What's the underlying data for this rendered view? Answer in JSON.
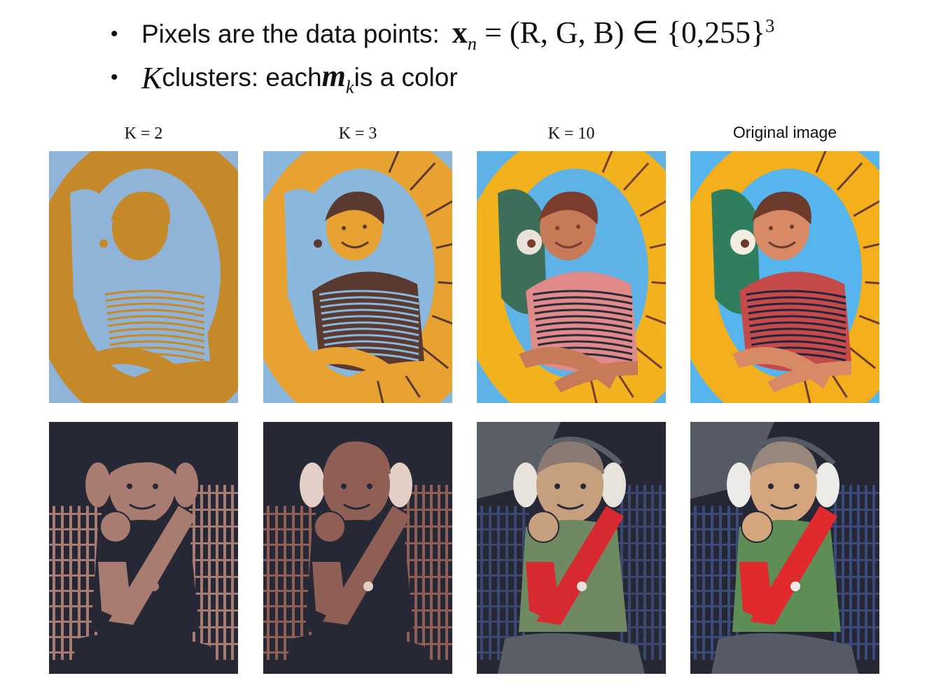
{
  "bullets": [
    {
      "text": "Pixels are the data points:",
      "math_var": "x",
      "math_sub": "n",
      "math_rest": " = (R, G, B) ∈ {0,255}",
      "math_sup": "3"
    },
    {
      "math_k": "K",
      "text": " clusters: each ",
      "math_m": "m",
      "math_m_sub": "k",
      "text2": " is a color"
    }
  ],
  "columns": [
    {
      "label": "K = 2"
    },
    {
      "label": "K = 3"
    },
    {
      "label": "K = 10"
    },
    {
      "label": "Original image"
    }
  ],
  "rows": [
    {
      "name": "boy-in-inflatable",
      "panels": [
        {
          "palette": [
            "#8fb4d8",
            "#c5892a"
          ]
        },
        {
          "palette": [
            "#8ab8dc",
            "#e8a232",
            "#5a3a30"
          ]
        },
        {
          "palette": [
            "#5fb2e6",
            "#f2b21e",
            "#c77a58",
            "#7a3d2e",
            "#e08a8a",
            "#3c6e5a",
            "#e9e2d8",
            "#2a2a38",
            "#a04a40",
            "#d4c0a0"
          ]
        },
        {
          "palette": [
            "#55b5ec",
            "#f4b01c",
            "#d88a66",
            "#6b3b2c",
            "#c54a4a",
            "#2f7f5e",
            "#f3ece0",
            "#24243a",
            "#e0a070",
            "#8fd0f0"
          ]
        }
      ]
    },
    {
      "name": "boy-in-airplane-seat",
      "panels": [
        {
          "palette": [
            "#262836",
            "#a97c72"
          ]
        },
        {
          "palette": [
            "#262836",
            "#8f5f55",
            "#e3cfc6"
          ]
        },
        {
          "palette": [
            "#262836",
            "#3b4870",
            "#d62a30",
            "#6f8a62",
            "#c6a07e",
            "#e8e2dc",
            "#8a7a72",
            "#5a5e66",
            "#b88a70",
            "#1b1c22"
          ]
        },
        {
          "palette": [
            "#252734",
            "#3a4a7a",
            "#e02a2e",
            "#5e8e56",
            "#d4a67e",
            "#ecebe8",
            "#98877b",
            "#555a64",
            "#c09070",
            "#15161c"
          ]
        }
      ]
    }
  ]
}
